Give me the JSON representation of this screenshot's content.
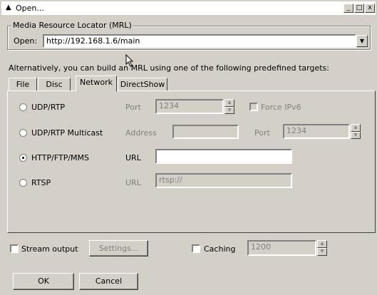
{
  "window": {
    "title": "Open...",
    "minimize": "_",
    "maximize": "□",
    "close": "x"
  },
  "mrl": {
    "group_label": "Media Resource Locator (MRL)",
    "open_label": "Open:",
    "open_value": "http://192.168.1.6/main"
  },
  "hint": "Alternatively, you can build an MRL using one of the following predefined targets:",
  "tabs": [
    {
      "label": "File",
      "active": false
    },
    {
      "label": "Disc",
      "active": false
    },
    {
      "label": "Network",
      "active": true
    },
    {
      "label": "DirectShow",
      "active": false
    }
  ],
  "network": {
    "udp": {
      "label": "UDP/RTP",
      "port_label": "Port",
      "port_value": "1234",
      "force_ipv6": "Force IPv6"
    },
    "udp_multicast": {
      "label": "UDP/RTP Multicast",
      "address_label": "Address",
      "address_value": "",
      "port_label": "Port",
      "port_value": "1234"
    },
    "http": {
      "label": "HTTP/FTP/MMS",
      "url_label": "URL",
      "url_value": "",
      "selected": true
    },
    "rtsp": {
      "label": "RTSP",
      "url_label": "URL",
      "url_value": "rtsp://"
    }
  },
  "footer": {
    "stream_output": "Stream output",
    "settings": "Settings...",
    "caching": "Caching",
    "caching_value": "1200",
    "ok": "OK",
    "cancel": "Cancel"
  }
}
